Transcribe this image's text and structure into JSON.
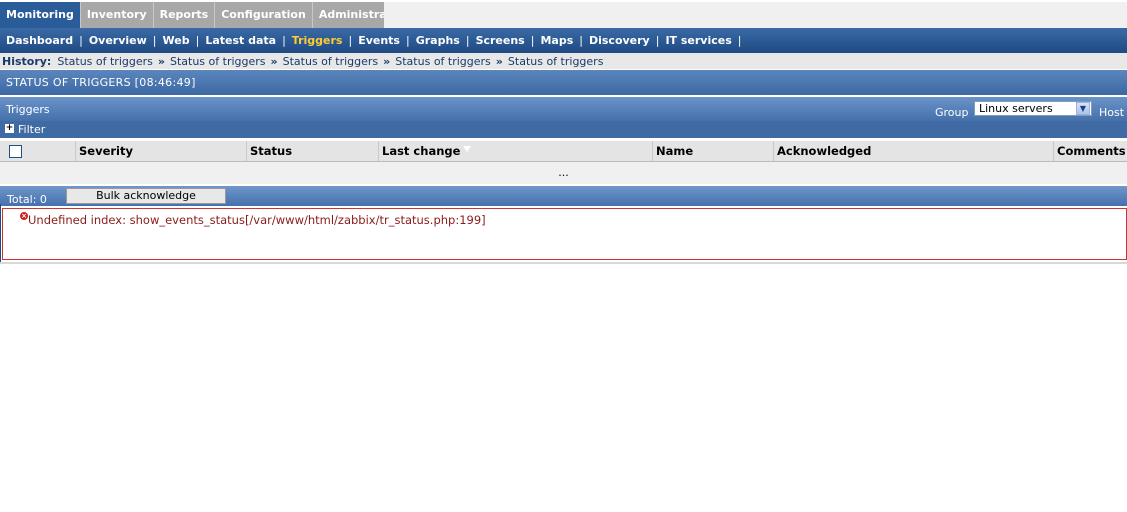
{
  "top_tabs": [
    {
      "label": "Monitoring",
      "active": true
    },
    {
      "label": "Inventory"
    },
    {
      "label": "Reports"
    },
    {
      "label": "Configuration"
    },
    {
      "label": "Administration"
    }
  ],
  "submenu": [
    {
      "label": "Dashboard"
    },
    {
      "label": "Overview"
    },
    {
      "label": "Web"
    },
    {
      "label": "Latest data"
    },
    {
      "label": "Triggers",
      "active": true
    },
    {
      "label": "Events"
    },
    {
      "label": "Graphs"
    },
    {
      "label": "Screens"
    },
    {
      "label": "Maps"
    },
    {
      "label": "Discovery"
    },
    {
      "label": "IT services"
    }
  ],
  "history": {
    "label": "History:",
    "items": [
      "Status of triggers",
      "Status of triggers",
      "Status of triggers",
      "Status of triggers",
      "Status of triggers"
    ]
  },
  "status_title": "STATUS OF TRIGGERS [08:46:49]",
  "triggers_bar": {
    "title": "Triggers",
    "group_label": "Group",
    "group_value": "Linux servers",
    "host_label": "Host"
  },
  "filter_label": "Filter",
  "table": {
    "columns": [
      "Severity",
      "Status",
      "Last change",
      "Name",
      "Acknowledged",
      "Comments"
    ],
    "empty_text": "..."
  },
  "footer": {
    "total": "Total: 0",
    "bulk_label": "Bulk acknowledge"
  },
  "error_text": "Undefined index: show_events_status[/var/www/html/zabbix/tr_status.php:199]",
  "colors": {
    "active_tab": "#2a5c9a",
    "active_submenu": "#ffcc33",
    "error": "#cc3333"
  }
}
